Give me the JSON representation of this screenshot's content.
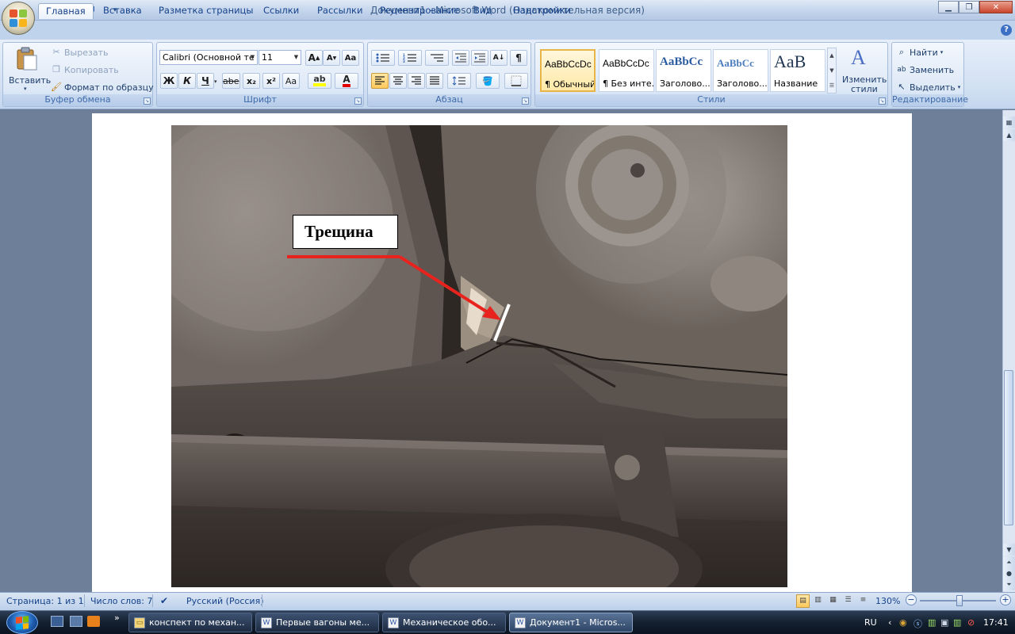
{
  "window": {
    "title": "Документ1 - Microsoft Word (Ознакомительная версия)"
  },
  "tabs": [
    {
      "label": "Главная",
      "active": true
    },
    {
      "label": "Вставка"
    },
    {
      "label": "Разметка страницы"
    },
    {
      "label": "Ссылки"
    },
    {
      "label": "Рассылки"
    },
    {
      "label": "Рецензирование"
    },
    {
      "label": "Вид"
    },
    {
      "label": "Надстройки"
    }
  ],
  "ribbon": {
    "clipboard": {
      "label": "Буфер обмена",
      "paste": "Вставить",
      "cut": "Вырезать",
      "copy": "Копировать",
      "format_painter": "Формат по образцу"
    },
    "font": {
      "label": "Шрифт",
      "font_name": "Calibri (Основной те",
      "font_size": "11",
      "bold": "Ж",
      "italic": "К",
      "underline": "Ч",
      "strike": "abe",
      "subscript": "x₂",
      "superscript": "x²",
      "change_case": "Aa",
      "grow": "A",
      "shrink": "A"
    },
    "paragraph": {
      "label": "Абзац",
      "pilcrow": "¶"
    },
    "styles": {
      "label": "Стили",
      "items": [
        {
          "sample": "AaBbCcDc",
          "name": "¶ Обычный",
          "selected": true
        },
        {
          "sample": "AaBbCcDc",
          "name": "¶ Без инте..."
        },
        {
          "sample": "AaBbCc",
          "name": "Заголово..."
        },
        {
          "sample": "AaBbCc",
          "name": "Заголово..."
        },
        {
          "sample": "AaB",
          "name": "Название"
        }
      ],
      "change_styles_line1": "Изменить",
      "change_styles_line2": "стили"
    },
    "editing": {
      "label": "Редактирование",
      "find": "Найти",
      "replace": "Заменить",
      "select": "Выделить"
    }
  },
  "document": {
    "annotation_label": "Трещина"
  },
  "statusbar": {
    "page": "Страница: 1 из 1",
    "words": "Число слов: 7",
    "language": "Русский (Россия)",
    "zoom": "130%"
  },
  "taskbar": {
    "items": [
      {
        "label": "конспект по механ..."
      },
      {
        "label": "Первые вагоны ме..."
      },
      {
        "label": "Механическое обо..."
      },
      {
        "label": "Документ1 - Micros...",
        "active": true
      }
    ],
    "lang": "RU",
    "clock": "17:41"
  },
  "colors": {
    "annotation_arrow": "#e8231d",
    "crack_marker": "#ffffff",
    "ribbon_bg": "#d2e0f3"
  }
}
